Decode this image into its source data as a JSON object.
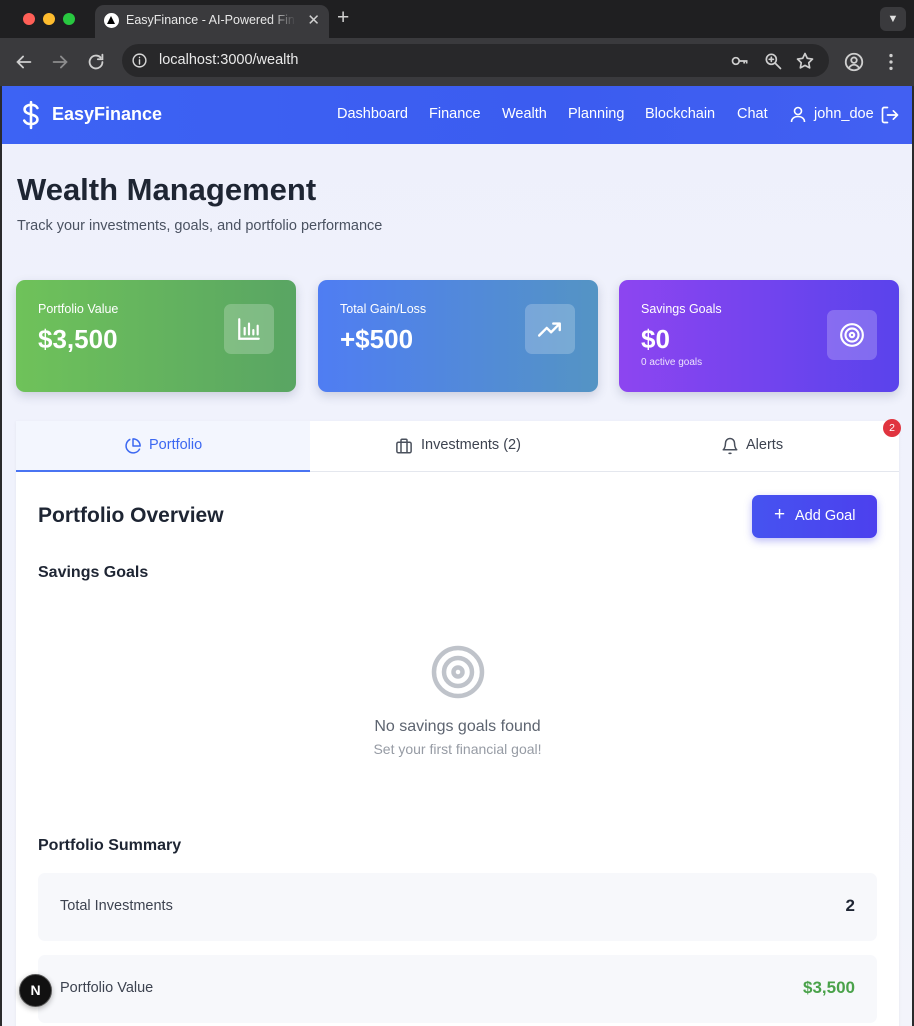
{
  "browser": {
    "tab_title": "EasyFinance - AI-Powered Finance",
    "url": "localhost:3000/wealth"
  },
  "nav": {
    "brand": "EasyFinance",
    "links": [
      "Dashboard",
      "Finance",
      "Wealth",
      "Planning",
      "Blockchain",
      "Chat"
    ],
    "user": "john_doe"
  },
  "header": {
    "title": "Wealth Management",
    "subtitle": "Track your investments, goals, and portfolio performance"
  },
  "cards": [
    {
      "label": "Portfolio Value",
      "value": "$3,500",
      "icon": "bar-chart-icon",
      "color": "#6fc25a"
    },
    {
      "label": "Total Gain/Loss",
      "value": "+$500",
      "icon": "trending-up-icon",
      "color": "#4f7df3"
    },
    {
      "label": "Savings Goals",
      "value": "$0",
      "note": "0 active goals",
      "icon": "target-icon",
      "color": "#8d45f0"
    }
  ],
  "tabs": [
    {
      "label": "Portfolio",
      "icon": "pie-chart-icon",
      "active": true
    },
    {
      "label": "Investments (2)",
      "icon": "briefcase-icon"
    },
    {
      "label": "Alerts",
      "icon": "bell-icon",
      "badge": "2"
    }
  ],
  "portfolio": {
    "title": "Portfolio Overview",
    "add_goal": "Add Goal",
    "goals_heading": "Savings Goals",
    "empty_title": "No savings goals found",
    "empty_sub": "Set your first financial goal!",
    "summary_heading": "Portfolio Summary",
    "summary": [
      {
        "label": "Total Investments",
        "value": "2"
      },
      {
        "label": "Portfolio Value",
        "value": "$3,500"
      }
    ]
  },
  "dev_indicator": "N",
  "accent_color": "#3d63f4"
}
